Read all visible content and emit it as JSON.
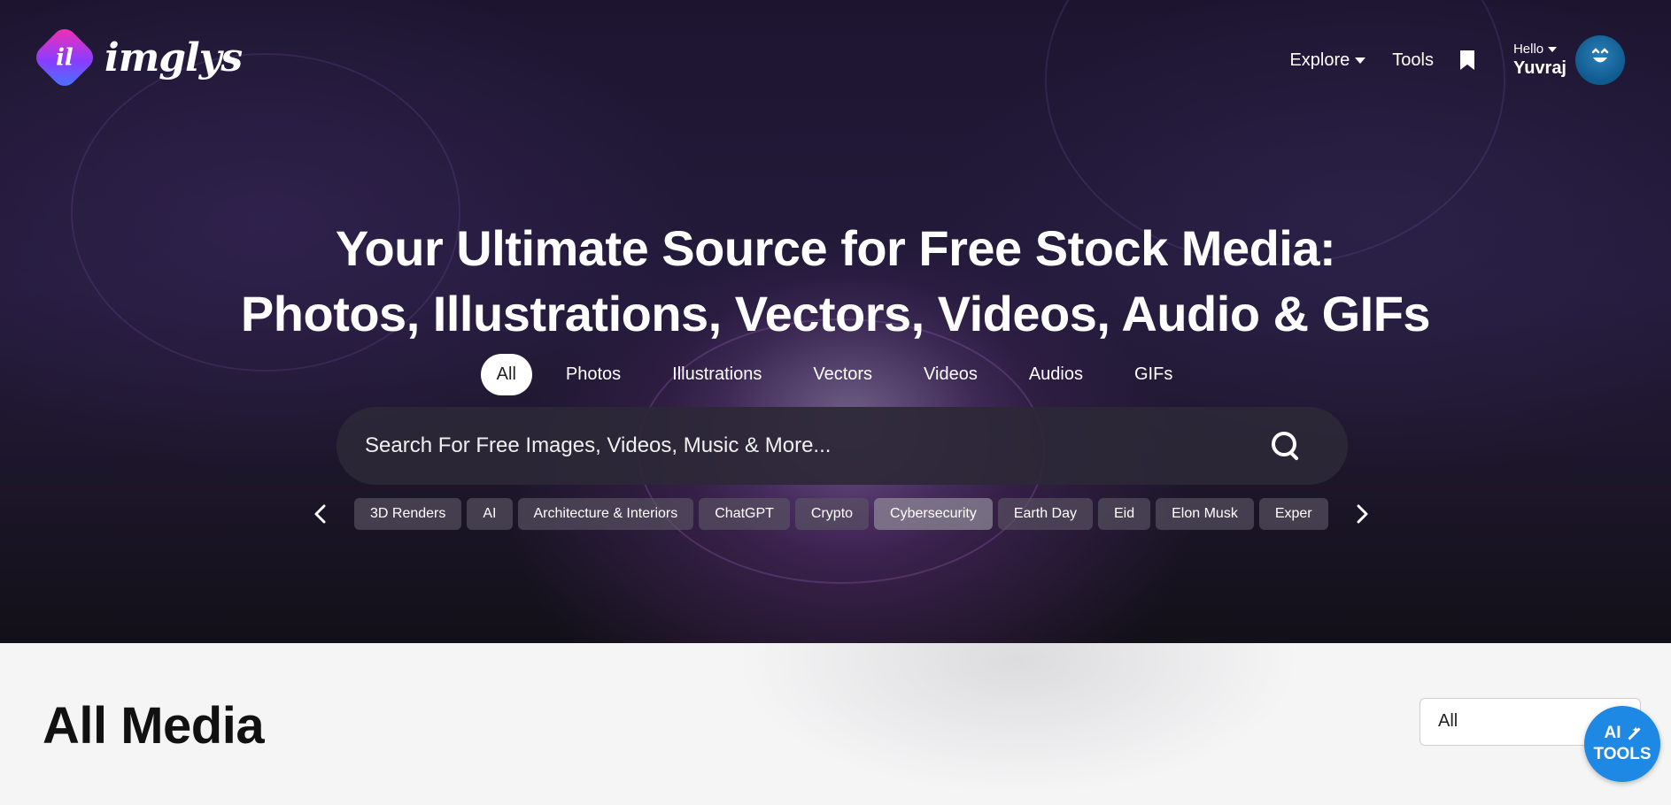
{
  "brand": {
    "logo_mark": "il",
    "name": "imglys"
  },
  "nav": {
    "explore_label": "Explore",
    "tools_label": "Tools",
    "greeting": "Hello",
    "username": "Yuvraj"
  },
  "hero": {
    "headline_line1": "Your Ultimate Source for Free Stock Media:",
    "headline_line2": "Photos, Illustrations, Vectors, Videos, Audio & GIFs",
    "tabs": [
      "All",
      "Photos",
      "Illustrations",
      "Vectors",
      "Videos",
      "Audios",
      "GIFs"
    ],
    "active_tab": "All",
    "search": {
      "placeholder": "Search For Free Images, Videos, Music & More...",
      "value": ""
    },
    "chips": [
      "3D Renders",
      "AI",
      "Architecture & Interiors",
      "ChatGPT",
      "Crypto",
      "Cybersecurity",
      "Earth Day",
      "Eid",
      "Elon Musk",
      "Exper"
    ],
    "highlighted_chip": "Cybersecurity"
  },
  "main": {
    "section_title": "All Media",
    "filter_value": "All",
    "ai_tools_line1": "AI",
    "ai_tools_line2": "TOOLS"
  },
  "icons": {
    "explore_caret": "chevron-down-icon",
    "bookmark": "bookmark-icon",
    "search": "search-icon",
    "prev": "chevron-left-icon",
    "next": "chevron-right-icon",
    "magic_wand": "magic-wand-icon"
  },
  "colors": {
    "accent": "#1e88e5",
    "hero_bg": "#1d1530",
    "logo_gradient_start": "#ff2fa8",
    "logo_gradient_end": "#3d7cff"
  }
}
